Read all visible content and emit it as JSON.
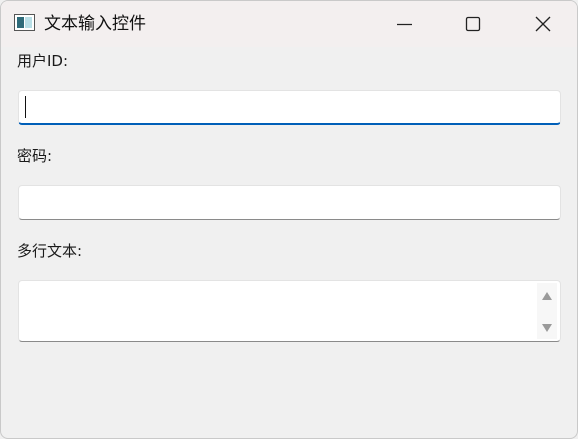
{
  "window": {
    "title": "文本输入控件",
    "icon": "app-window-icon",
    "controls": {
      "minimize": "minimize-icon",
      "maximize": "maximize-icon",
      "close": "close-icon"
    }
  },
  "form": {
    "user_id": {
      "label": "用户ID:",
      "value": "",
      "focused": true
    },
    "password": {
      "label": "密码:",
      "value": ""
    },
    "multiline": {
      "label": "多行文本:",
      "value": ""
    }
  },
  "colors": {
    "focus_accent": "#005fb8",
    "background": "#f0f0f0",
    "titlebar": "#f3efef"
  }
}
